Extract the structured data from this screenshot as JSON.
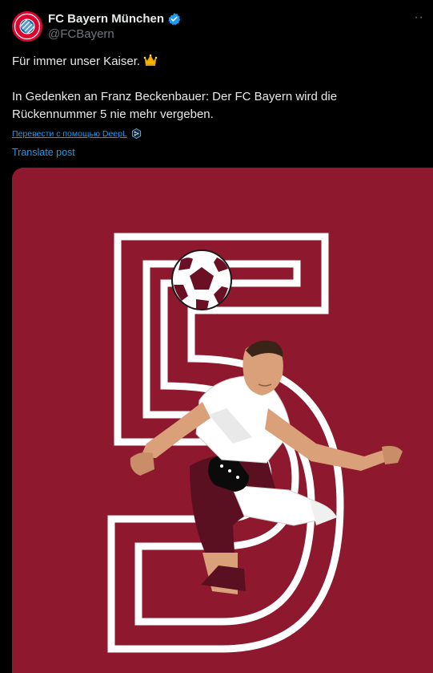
{
  "account": {
    "display_name": "FC Bayern München",
    "handle": "@FCBayern",
    "avatar_text": "FC BAYERN MÜNCHEN",
    "verified": true,
    "more_icon": "more-icon"
  },
  "post": {
    "line1": "Für immer unser Kaiser.",
    "line1_emoji": "crown",
    "line2": "In Gedenken an Franz Beckenbauer: Der FC Bayern wird die Rückennummer 5 nie mehr vergeben."
  },
  "deepl_link": "Перевести с помощью DeepL",
  "translate_link": "Translate post",
  "media": {
    "description": "illustration",
    "background_color": "#8e192e",
    "accent_color": "#ffffff"
  },
  "colors": {
    "link": "#1d9bf0",
    "muted": "#71767b",
    "text": "#e7e9ea",
    "verified": "#1d9bf0"
  }
}
